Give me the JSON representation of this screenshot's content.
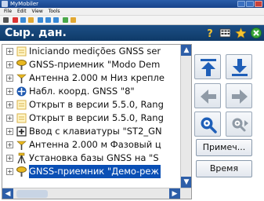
{
  "window": {
    "title": "MyMobiler"
  },
  "menu": [
    "File",
    "Edit",
    "View",
    "Tools"
  ],
  "header": {
    "title": "Сыр. дан."
  },
  "tree": {
    "items": [
      {
        "label": "Iniciando medições GNSS ser",
        "icon": "document-icon",
        "selected": false
      },
      {
        "label": "GNSS-приемник \"Modo Dem",
        "icon": "gnss-receiver-icon",
        "selected": false
      },
      {
        "label": "Антенна 2.000 м Низ крепле",
        "icon": "antenna-icon",
        "selected": false
      },
      {
        "label": "Набл. коорд. GNSS \"8\"",
        "icon": "crosshair-icon",
        "selected": false
      },
      {
        "label": "Открыт в версии 5.5.0, Rang",
        "icon": "document-icon",
        "selected": false
      },
      {
        "label": "Открыт в версии 5.5.0, Rang",
        "icon": "document-icon",
        "selected": false
      },
      {
        "label": "Ввод с клавиатуры \"ST2_GN",
        "icon": "keypad-icon",
        "selected": false
      },
      {
        "label": "Антенна 2.000 м Фазовый ц",
        "icon": "antenna-icon",
        "selected": false
      },
      {
        "label": "Установка базы GNSS на \"S",
        "icon": "tripod-icon",
        "selected": false
      },
      {
        "label": "GNSS-приемник \"Демо-реж",
        "icon": "gnss-receiver-icon",
        "selected": true
      }
    ]
  },
  "buttons": {
    "notes": "Примеч...",
    "time": "Время"
  },
  "colors": {
    "header": "#1c4f86",
    "selection": "#0a4fb5",
    "arrow_blue": "#1f5fb8",
    "arrow_grey": "#8f9aa6"
  }
}
